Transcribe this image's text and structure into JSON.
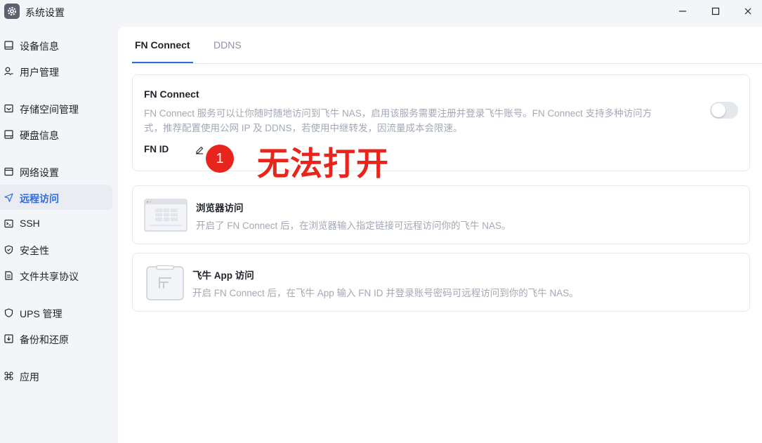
{
  "window": {
    "title": "系统设置",
    "icons": {
      "app": "gear-icon",
      "minimize": "minimize-icon",
      "maximize": "maximize-icon",
      "close": "close-icon"
    }
  },
  "sidebar": {
    "items": [
      {
        "label": "设备信息",
        "icon": "device-icon",
        "active": false
      },
      {
        "label": "用户管理",
        "icon": "user-icon",
        "active": false
      },
      {
        "label": "存储空间管理",
        "icon": "storage-icon",
        "active": false
      },
      {
        "label": "硬盘信息",
        "icon": "disk-icon",
        "active": false
      },
      {
        "label": "网络设置",
        "icon": "network-icon",
        "active": false
      },
      {
        "label": "远程访问",
        "icon": "send-icon",
        "active": true
      },
      {
        "label": "SSH",
        "icon": "terminal-icon",
        "active": false
      },
      {
        "label": "安全性",
        "icon": "shield-icon",
        "active": false
      },
      {
        "label": "文件共享协议",
        "icon": "file-icon",
        "active": false
      },
      {
        "label": "UPS 管理",
        "icon": "ups-shield-icon",
        "active": false
      },
      {
        "label": "备份和还原",
        "icon": "backup-icon",
        "active": false
      },
      {
        "label": "应用",
        "icon": "command-icon",
        "active": false
      }
    ]
  },
  "tabs": [
    {
      "label": "FN Connect",
      "active": true
    },
    {
      "label": "DDNS",
      "active": false
    }
  ],
  "fn_connect": {
    "title": "FN Connect",
    "desc_line1": "FN Connect 服务可以让你随时随地访问到飞牛 NAS，启用该服务需要注册并登录飞牛账号。FN Connect 支持多种访问方",
    "desc_line2": "式，推荐配置使用公网 IP 及 DDNS，若使用中继转发，因流量成本会限速。",
    "toggle_on": false,
    "fn_id_label": "FN ID"
  },
  "browser_access": {
    "title": "浏览器访问",
    "desc": "开启了 FN Connect 后，在浏览器输入指定链接可远程访问你的飞牛 NAS。",
    "icon": "browser-window-icon"
  },
  "app_access": {
    "title": "飞牛 App 访问",
    "desc": "开启 FN Connect 后，在飞牛 App 输入 FN ID 并登录账号密码可远程访问到你的飞牛 NAS。",
    "icon": "phone-app-icon"
  },
  "annotation": {
    "badge_number": "1",
    "text": "无法打开",
    "color": "#e8251d"
  },
  "colors": {
    "accent": "#2f6bdc",
    "muted_text": "#a2a9b6",
    "sidebar_bg": "#f3f5f8"
  }
}
